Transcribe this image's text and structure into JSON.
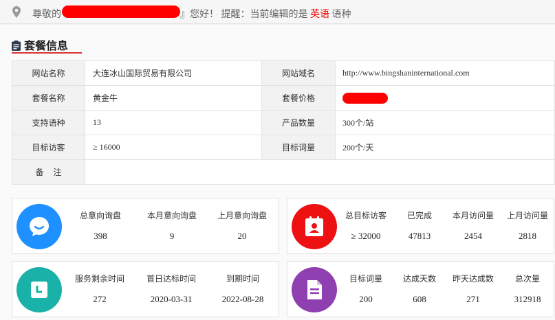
{
  "topbar": {
    "greeting_prefix": "尊敬的",
    "greeting_suffix": "』您好！ 提醒：当前编辑的是",
    "language": "英语",
    "language_suffix": " 语种",
    "colors": {
      "language": "#e00000",
      "redaction": "#ff0000"
    }
  },
  "section": {
    "title": "套餐信息",
    "icon": "clipboard-icon",
    "underline_color": "#dd3333"
  },
  "info": {
    "site_name_label": "网站名称",
    "site_name": "大连冰山国际贸易有限公司",
    "domain_label": "网站域名",
    "domain": "http://www.bingshaninternational.com",
    "plan_label": "套餐名称",
    "plan": "黄金牛",
    "price_label": "套餐价格",
    "languages_label": "支持语种",
    "languages": "13",
    "products_label": "产品数量",
    "products": "300个/站",
    "visitors_label": "目标访客",
    "visitors": "≥ 16000",
    "keywords_label": "目标词量",
    "keywords": "200个/天",
    "remark_label": "备注",
    "remark": ""
  },
  "cards": {
    "inquiry": {
      "icon": "chat-bubble-icon",
      "color": "#1e90ff",
      "stats": [
        {
          "label": "总意向询盘",
          "value": "398"
        },
        {
          "label": "本月意向询盘",
          "value": "9"
        },
        {
          "label": "上月意向询盘",
          "value": "20"
        }
      ]
    },
    "visitors": {
      "icon": "contact-card-icon",
      "color": "#ee1111",
      "stats": [
        {
          "label": "总目标访客",
          "value": "≥ 32000"
        },
        {
          "label": "已完成",
          "value": "47813"
        },
        {
          "label": "本月访问量",
          "value": "2454"
        },
        {
          "label": "上月访问量",
          "value": "2818"
        }
      ]
    },
    "service": {
      "icon": "clock-icon",
      "color": "#1ab2a8",
      "stats": [
        {
          "label": "服务剩余时间",
          "value": "272"
        },
        {
          "label": "首日达标时间",
          "value": "2020-03-31"
        },
        {
          "label": "到期时间",
          "value": "2022-08-28"
        }
      ]
    },
    "keywords": {
      "icon": "document-icon",
      "color": "#8e3fb0",
      "stats": [
        {
          "label": "目标词量",
          "value": "200"
        },
        {
          "label": "达成天数",
          "value": "608"
        },
        {
          "label": "昨天达成数",
          "value": "271"
        },
        {
          "label": "总次量",
          "value": "312918"
        }
      ]
    }
  }
}
